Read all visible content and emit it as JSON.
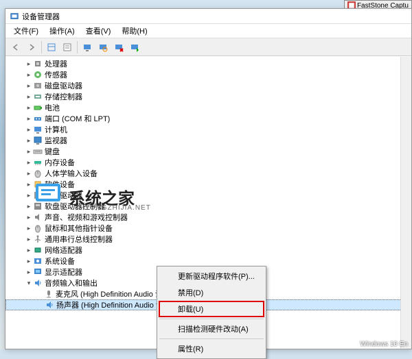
{
  "window": {
    "title": "设备管理器"
  },
  "menubar": {
    "items": [
      "文件(F)",
      "操作(A)",
      "查看(V)",
      "帮助(H)"
    ]
  },
  "tree": {
    "nodes": [
      {
        "level": 1,
        "icon": "cpu",
        "label": "处理器",
        "exp": ">"
      },
      {
        "level": 1,
        "icon": "sensor",
        "label": "传感器",
        "exp": ">"
      },
      {
        "level": 1,
        "icon": "disk",
        "label": "磁盘驱动器",
        "exp": ">"
      },
      {
        "level": 1,
        "icon": "storage",
        "label": "存储控制器",
        "exp": ">"
      },
      {
        "level": 1,
        "icon": "battery",
        "label": "电池",
        "exp": ">"
      },
      {
        "level": 1,
        "icon": "port",
        "label": "端口 (COM 和 LPT)",
        "exp": ">"
      },
      {
        "level": 1,
        "icon": "computer",
        "label": "计算机",
        "exp": ">"
      },
      {
        "level": 1,
        "icon": "monitor",
        "label": "监视器",
        "exp": ">"
      },
      {
        "level": 1,
        "icon": "keyboard",
        "label": "键盘",
        "exp": ">"
      },
      {
        "level": 1,
        "icon": "memory",
        "label": "内存设备",
        "exp": ">"
      },
      {
        "level": 1,
        "icon": "hid",
        "label": "人体学输入设备",
        "exp": ">"
      },
      {
        "level": 1,
        "icon": "software",
        "label": "软件设备",
        "exp": ">"
      },
      {
        "level": 1,
        "icon": "floppy",
        "label": "软盘驱动器",
        "exp": ">"
      },
      {
        "level": 1,
        "icon": "floppyctl",
        "label": "软盘驱动器控制器",
        "exp": ">"
      },
      {
        "level": 1,
        "icon": "audio",
        "label": "声音、视频和游戏控制器",
        "exp": ">"
      },
      {
        "level": 1,
        "icon": "mouse",
        "label": "鼠标和其他指针设备",
        "exp": ">"
      },
      {
        "level": 1,
        "icon": "usb",
        "label": "通用串行总线控制器",
        "exp": ">"
      },
      {
        "level": 1,
        "icon": "network",
        "label": "网络适配器",
        "exp": ">"
      },
      {
        "level": 1,
        "icon": "system",
        "label": "系统设备",
        "exp": ">"
      },
      {
        "level": 1,
        "icon": "display",
        "label": "显示适配器",
        "exp": ">"
      },
      {
        "level": 1,
        "icon": "audioinout",
        "label": "音频输入和输出",
        "exp": "▾",
        "expanded": true
      },
      {
        "level": 2,
        "icon": "mic",
        "label": "麦克风 (High Definition Audio 设备)",
        "exp": ""
      },
      {
        "level": 2,
        "icon": "speaker",
        "label": "扬声器 (High Definition Audio 设备)",
        "exp": "",
        "selected": true
      }
    ]
  },
  "context_menu": {
    "items": [
      {
        "label": "更新驱动程序软件(P)...",
        "type": "item"
      },
      {
        "label": "禁用(D)",
        "type": "item"
      },
      {
        "label": "卸载(U)",
        "type": "item",
        "highlighted": true
      },
      {
        "type": "sep"
      },
      {
        "label": "扫描检测硬件改动(A)",
        "type": "item"
      },
      {
        "type": "sep"
      },
      {
        "label": "属性(R)",
        "type": "item"
      }
    ]
  },
  "watermark": {
    "main": "系统之家",
    "sub": "ITONGZHIJIA.NET"
  },
  "footer": {
    "win10": "Windows 10 En"
  },
  "taskbar_app": {
    "label": "FastStone Captu"
  }
}
